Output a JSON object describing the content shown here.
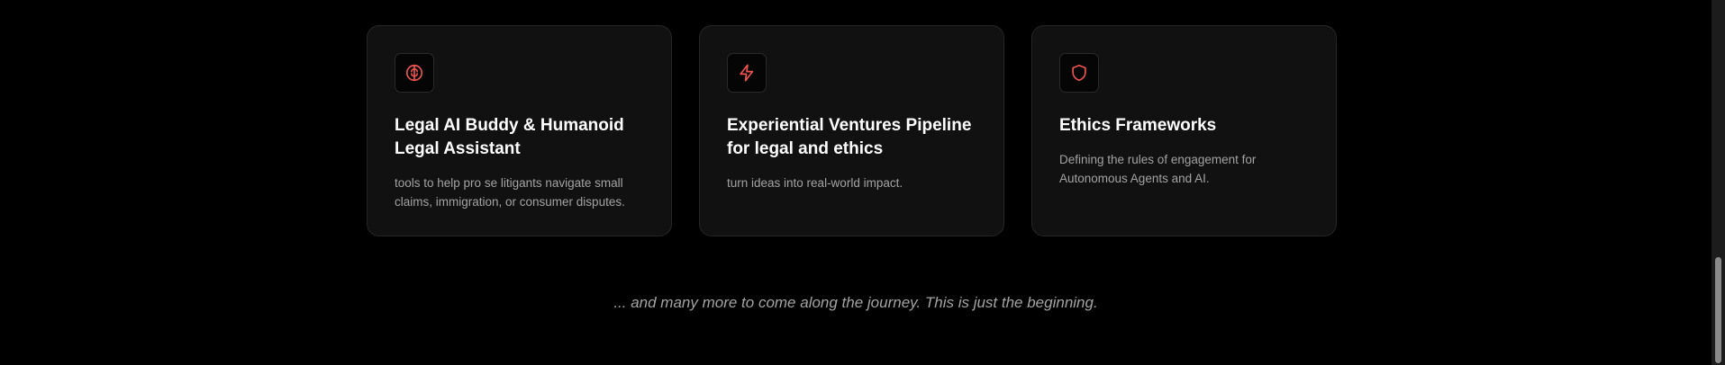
{
  "cards": [
    {
      "icon": "brain-icon",
      "title": "Legal AI Buddy & Humanoid Legal Assistant",
      "description": "tools to help pro se litigants navigate small claims, immigration, or consumer disputes."
    },
    {
      "icon": "lightning-icon",
      "title": "Experiential Ventures Pipeline for legal and ethics",
      "description": "turn ideas into real-world impact."
    },
    {
      "icon": "shield-icon",
      "title": "Ethics Frameworks",
      "description": "Defining the rules of engagement for Autonomous Agents and AI."
    }
  ],
  "tagline": "... and many more to come along the journey. This is just the beginning.",
  "colors": {
    "background": "#000000",
    "card_background": "#111111",
    "accent": "#ef5350",
    "title": "#ffffff",
    "muted_text": "#a3a3a3"
  }
}
